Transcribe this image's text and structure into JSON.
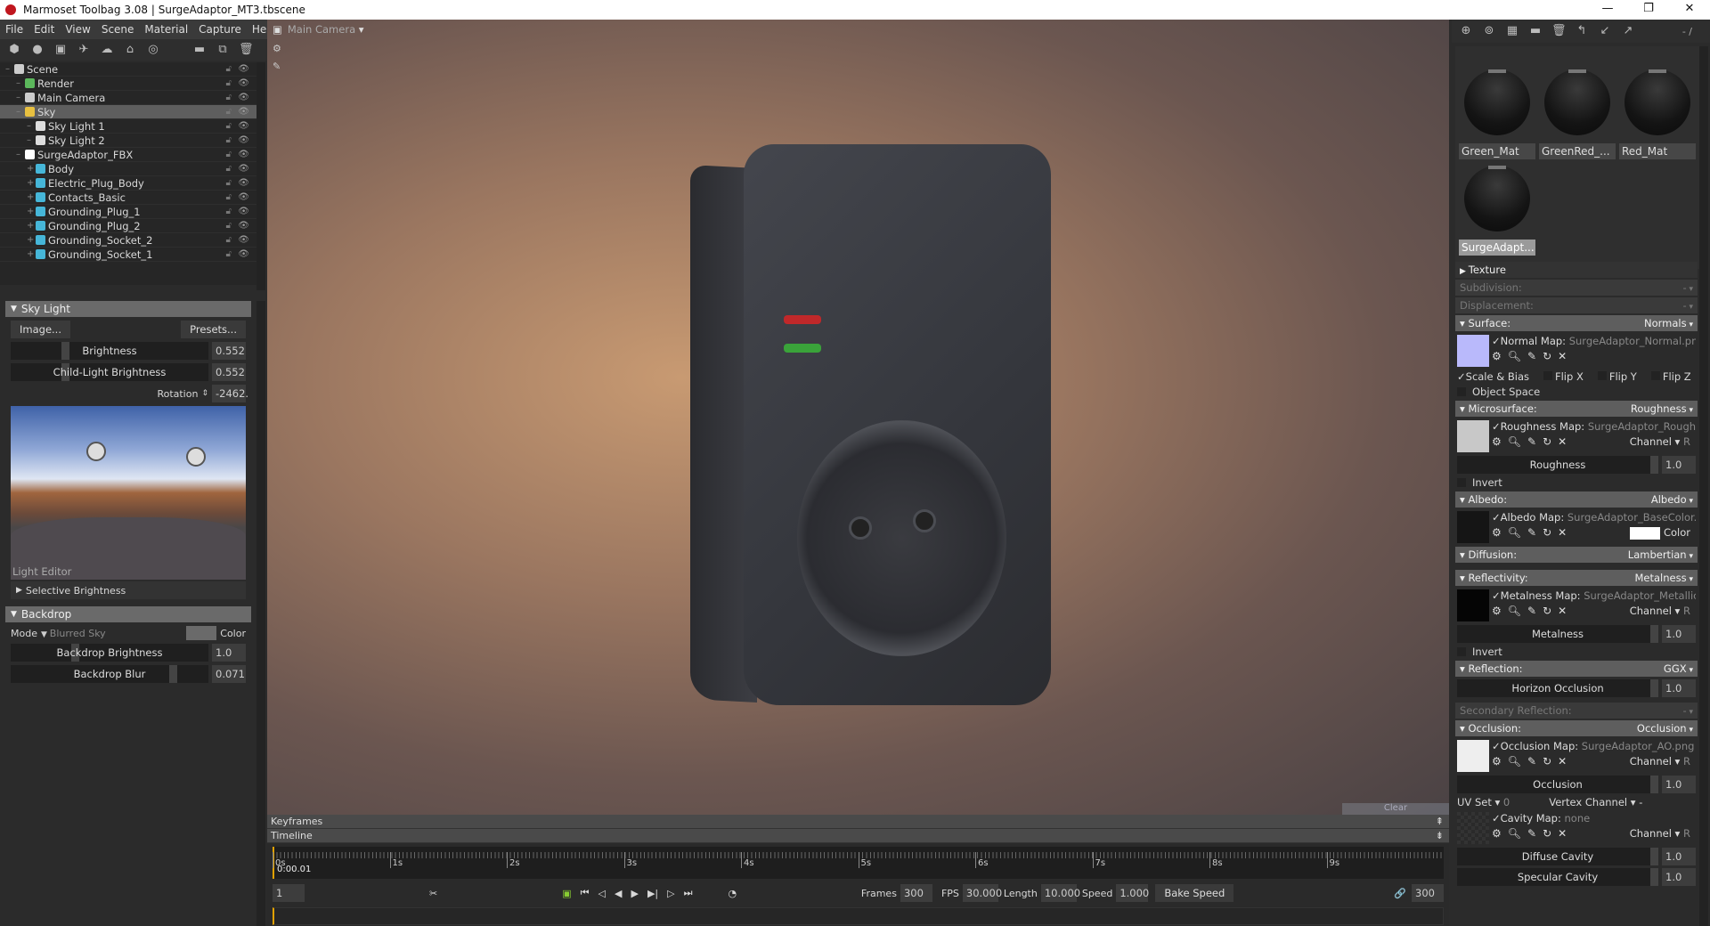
{
  "window": {
    "title": "Marmoset Toolbag 3.08  |  SurgeAdaptor_MT3.tbscene",
    "minimize": "—",
    "restore": "❐",
    "close": "✕"
  },
  "menu": [
    "File",
    "Edit",
    "View",
    "Scene",
    "Material",
    "Capture",
    "Help"
  ],
  "scene_tree": [
    {
      "label": "Scene",
      "level": 0,
      "icon": "scene-icon",
      "color": "#cccccc"
    },
    {
      "label": "Render",
      "level": 1,
      "icon": "gear-icon",
      "color": "#5cb85c"
    },
    {
      "label": "Main Camera",
      "level": 1,
      "icon": "camera-icon",
      "color": "#cccccc"
    },
    {
      "label": "Sky",
      "level": 1,
      "icon": "sky-icon",
      "color": "#e8c040",
      "selected": true
    },
    {
      "label": "Sky Light 1",
      "level": 2,
      "icon": "bulb-icon",
      "color": "#dddddd"
    },
    {
      "label": "Sky Light 2",
      "level": 2,
      "icon": "bulb-icon",
      "color": "#dddddd"
    },
    {
      "label": "SurgeAdaptor_FBX",
      "level": 1,
      "icon": "group-icon",
      "color": "#ffffff"
    },
    {
      "label": "Body",
      "level": 2,
      "icon": "mesh-icon",
      "color": "#46b6d8"
    },
    {
      "label": "Electric_Plug_Body",
      "level": 2,
      "icon": "mesh-icon",
      "color": "#46b6d8"
    },
    {
      "label": "Contacts_Basic",
      "level": 2,
      "icon": "mesh-icon",
      "color": "#46b6d8"
    },
    {
      "label": "Grounding_Plug_1",
      "level": 2,
      "icon": "mesh-icon",
      "color": "#46b6d8"
    },
    {
      "label": "Grounding_Plug_2",
      "level": 2,
      "icon": "mesh-icon",
      "color": "#46b6d8"
    },
    {
      "label": "Grounding_Socket_2",
      "level": 2,
      "icon": "mesh-icon",
      "color": "#46b6d8"
    },
    {
      "label": "Grounding_Socket_1",
      "level": 2,
      "icon": "mesh-icon",
      "color": "#46b6d8"
    }
  ],
  "sky_light": {
    "title": "Sky Light",
    "image_btn": "Image...",
    "presets_btn": "Presets...",
    "brightness_label": "Brightness",
    "brightness": "0.552",
    "child_label": "Child-Light Brightness",
    "child": "0.552",
    "rotation_label": "Rotation",
    "rotation": "-2462.",
    "light_editor": "Light Editor",
    "selective": "Selective Brightness"
  },
  "backdrop": {
    "title": "Backdrop",
    "mode_label": "Mode",
    "mode": "Blurred Sky",
    "color_label": "Color",
    "brightness_label": "Backdrop Brightness",
    "brightness": "1.0",
    "blur_label": "Backdrop Blur",
    "blur": "0.071"
  },
  "viewport": {
    "camera": "Main Camera",
    "overlay": "Clear"
  },
  "timeline": {
    "keyframes": "Keyframes",
    "timeline": "Timeline",
    "ticks": [
      "0s",
      "1s",
      "2s",
      "3s",
      "4s",
      "5s",
      "6s",
      "7s",
      "8s",
      "9s"
    ],
    "current_time": "0:00.01",
    "frame": "1",
    "frames_label": "Frames",
    "frames": "300",
    "fps_label": "FPS",
    "fps": "30.000",
    "length_label": "Length",
    "length": "10.000",
    "speed_label": "Speed",
    "speed": "1.000",
    "bake": "Bake Speed",
    "end_frame": "300"
  },
  "materials": {
    "page": "- /",
    "items": [
      "Green_Mat",
      "GreenRed_...",
      "Red_Mat",
      "SurgeAdapt..."
    ]
  },
  "props": {
    "texture": "Texture",
    "subdivision": "Subdivision:",
    "displacement": "Displacement:",
    "dash": "-",
    "surface": "Surface:",
    "surface_v": "Normals",
    "normal_map": "Normal Map:",
    "normal_file": "SurgeAdaptor_Normal.png",
    "scale_bias": "Scale & Bias",
    "flipx": "Flip X",
    "flipy": "Flip Y",
    "flipz": "Flip Z",
    "object_space": "Object Space",
    "micro": "Microsurface:",
    "micro_v": "Roughness",
    "rough_map": "Roughness Map:",
    "rough_file": "SurgeAdaptor_Roughness.png",
    "channel": "Channel",
    "channel_v": "R",
    "roughness": "Roughness",
    "one": "1.0",
    "invert": "Invert",
    "albedo": "Albedo:",
    "albedo_v": "Albedo",
    "albedo_map": "Albedo Map:",
    "albedo_file": "SurgeAdaptor_BaseColor.png",
    "color": "Color",
    "diffusion": "Diffusion:",
    "diffusion_v": "Lambertian",
    "reflectivity": "Reflectivity:",
    "reflectivity_v": "Metalness",
    "metal_map": "Metalness Map:",
    "metal_file": "SurgeAdaptor_Metallic.png",
    "metalness": "Metalness",
    "reflection": "Reflection:",
    "reflection_v": "GGX",
    "horizon": "Horizon Occlusion",
    "secondary": "Secondary Reflection:",
    "occlusion": "Occlusion:",
    "occlusion_v": "Occlusion",
    "ao_map": "Occlusion Map:",
    "ao_file": "SurgeAdaptor_AO.png",
    "occ": "Occlusion",
    "uvset": "UV Set",
    "uvset_v": "0",
    "vertex": "Vertex Channel",
    "vertex_v": "-",
    "cavity_map": "Cavity Map:",
    "cavity_file": "none",
    "diffuse_cavity": "Diffuse Cavity",
    "specular_cavity": "Specular Cavity"
  }
}
